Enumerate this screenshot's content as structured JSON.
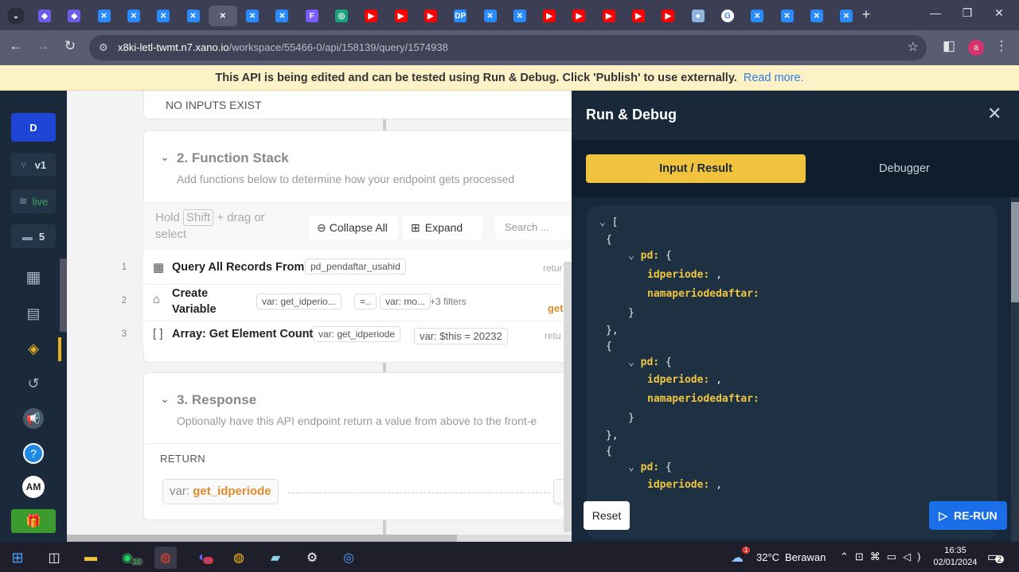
{
  "browser": {
    "tabs": [
      {
        "icon": "xano-icon",
        "color": "#6c5ce7",
        "glyph": "◆"
      },
      {
        "icon": "xano-icon",
        "color": "#6c5ce7",
        "glyph": "◆"
      },
      {
        "icon": "x-icon",
        "color": "#2a8bff",
        "glyph": "✕"
      },
      {
        "icon": "x-icon",
        "color": "#2a8bff",
        "glyph": "✕"
      },
      {
        "icon": "x-icon",
        "color": "#2a8bff",
        "glyph": "✕"
      },
      {
        "icon": "x-icon",
        "color": "#2a8bff",
        "glyph": "✕"
      },
      {
        "icon": "close-icon",
        "color": "#5a5d72",
        "glyph": "✕"
      },
      {
        "icon": "x-icon",
        "color": "#2a8bff",
        "glyph": "✕"
      },
      {
        "icon": "x-icon",
        "color": "#2a8bff",
        "glyph": "✕"
      },
      {
        "icon": "f-icon",
        "color": "#7b5cff",
        "glyph": "F"
      },
      {
        "icon": "chatgpt-icon",
        "color": "#19a37f",
        "glyph": "◎"
      },
      {
        "icon": "youtube-icon",
        "color": "#ff0000",
        "glyph": "▶"
      },
      {
        "icon": "youtube-icon",
        "color": "#ff0000",
        "glyph": "▶"
      },
      {
        "icon": "youtube-icon",
        "color": "#ff0000",
        "glyph": "▶"
      },
      {
        "icon": "dp-icon",
        "color": "#2a8bff",
        "glyph": "DP"
      },
      {
        "icon": "x-icon",
        "color": "#2a8bff",
        "glyph": "✕"
      },
      {
        "icon": "x-icon",
        "color": "#2a8bff",
        "glyph": "✕"
      },
      {
        "icon": "youtube-icon",
        "color": "#ff0000",
        "glyph": "▶"
      },
      {
        "icon": "youtube-icon",
        "color": "#ff0000",
        "glyph": "▶"
      },
      {
        "icon": "youtube-icon",
        "color": "#ff0000",
        "glyph": "▶"
      },
      {
        "icon": "youtube-icon",
        "color": "#ff0000",
        "glyph": "▶"
      },
      {
        "icon": "youtube-icon",
        "color": "#ff0000",
        "glyph": "▶"
      },
      {
        "icon": "globe-icon",
        "color": "#8fb4e0",
        "glyph": "●"
      },
      {
        "icon": "google-icon",
        "color": "#ffffff",
        "glyph": "G"
      },
      {
        "icon": "x-box-icon",
        "color": "#2a8bff",
        "glyph": "✕"
      },
      {
        "icon": "x-box-icon",
        "color": "#2a8bff",
        "glyph": "✕"
      },
      {
        "icon": "x-box-icon",
        "color": "#2a8bff",
        "glyph": "✕"
      },
      {
        "icon": "x-box-icon",
        "color": "#2a8bff",
        "glyph": "✕"
      }
    ],
    "url_host": "x8ki-letl-twmt.n7.xano.io",
    "url_path": "/workspace/55466-0/api/158139/query/1574938",
    "profile_initial": "a"
  },
  "banner": {
    "text": "This API is being edited and can be tested using Run & Debug. Click 'Publish' to use externally.",
    "link": "Read more."
  },
  "leftnav": {
    "workspace_initial": "D",
    "branch": "v1",
    "datasource": "live",
    "comments_count": "5",
    "user_initials": "AM"
  },
  "main": {
    "inputs_empty": "NO INPUTS EXIST",
    "function_stack": {
      "title": "2. Function Stack",
      "description": "Add functions below to determine how your endpoint gets processed",
      "hint_hold": "Hold",
      "hint_key": "Shift",
      "hint_rest1": "+ drag or",
      "hint_rest2": "select",
      "collapse_all": "Collapse All",
      "expand": "Expand",
      "search_placeholder": "Search ...",
      "rows": [
        {
          "num": "1",
          "title": "Query All Records From",
          "pill1": "pd_pendaftar_usahid",
          "right": "retur"
        },
        {
          "num": "2",
          "title_line1": "Create",
          "title_line2": "Variable",
          "pill1": "var: get_idperio...",
          "pill2": "=..",
          "pill3": "var: mo...",
          "pill4": "+3 filters",
          "right": "get"
        },
        {
          "num": "3",
          "title": "Array: Get Element Count",
          "pill1": "var: get_idperiode",
          "pill2": "var: $this = 20232",
          "right": "retu"
        }
      ]
    },
    "response": {
      "title": "3. Response",
      "description": "Optionally have this API endpoint return a value from above to the front-e",
      "return_label": "RETURN",
      "return_prefix": "var:",
      "return_var": "get_idperiode"
    }
  },
  "run_debug": {
    "title": "Run & Debug",
    "tab_active": "Input / Result",
    "tab_inactive": "Debugger",
    "reset": "Reset",
    "rerun": "RE-RUN",
    "code": {
      "open_bracket": "[",
      "open_brace": "{",
      "pd_key": "pd:",
      "idperiode_key": "idperiode:",
      "idperiode_val": ",",
      "nama_key": "namaperiodedaftar:",
      "close_brace": "}",
      "close_brace_comma": "},"
    }
  },
  "taskbar": {
    "whatsapp_badge": "16",
    "discord_badge": "9+",
    "temperature": "32°C",
    "weather": "Berawan",
    "time": "16:35",
    "date": "02/01/2024",
    "notif_count": "2",
    "weather_badge": "1"
  }
}
